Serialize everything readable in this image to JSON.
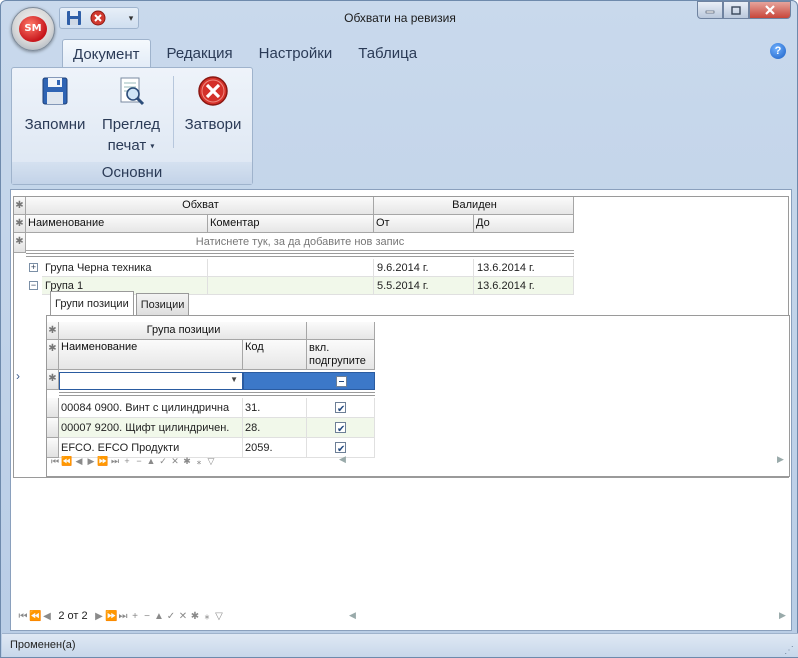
{
  "window": {
    "title": "Обхвати на ревизия",
    "app_logo": "SM",
    "qat_dropdown": "▾"
  },
  "ribbon": {
    "tabs": [
      "Документ",
      "Редакция",
      "Настройки",
      "Таблица"
    ],
    "active_tab": "Документ",
    "group_label": "Основни",
    "buttons": {
      "save": "Запомни",
      "preview_line1": "Преглед",
      "preview_line2": "печат",
      "close": "Затвори"
    },
    "help": "?"
  },
  "main_grid": {
    "band_scope": "Обхват",
    "band_valid": "Валиден",
    "columns": [
      "Наименование",
      "Коментар",
      "От",
      "До"
    ],
    "new_row_hint": "Натиснете тук, за да добавите нов запис",
    "rows": [
      {
        "expander": "+",
        "name": "Група Черна техника",
        "comment": "",
        "from": "9.6.2014 г.",
        "to": "13.6.2014 г."
      },
      {
        "expander": "−",
        "name": "Група 1",
        "comment": "",
        "from": "5.5.2014 г.",
        "to": "13.6.2014 г."
      }
    ],
    "page_indicator": "2 от 2"
  },
  "detail": {
    "tabs": [
      "Групи позиции",
      "Позиции"
    ],
    "active_tab": "Групи позиции",
    "band": "Група позиции",
    "columns": [
      "Наименование",
      "Код",
      "вкл. подгрупите"
    ],
    "include_header_line1": "вкл.",
    "include_header_line2": "подгрупите",
    "rows": [
      {
        "name": "00084 0900. Винт с цилиндрична",
        "code": "31.",
        "include": true
      },
      {
        "name": "00007 9200. Щифт цилиндричен.",
        "code": "28.",
        "include": true
      },
      {
        "name": "EFCO. EFCO Продукти",
        "code": "2059.",
        "include": true
      }
    ]
  },
  "status": {
    "text": "Променен(а)"
  },
  "colors": {
    "accent": "#3c78c8",
    "ribbon_bg": "#dce6f2",
    "alt_row": "#f1f8ea"
  }
}
